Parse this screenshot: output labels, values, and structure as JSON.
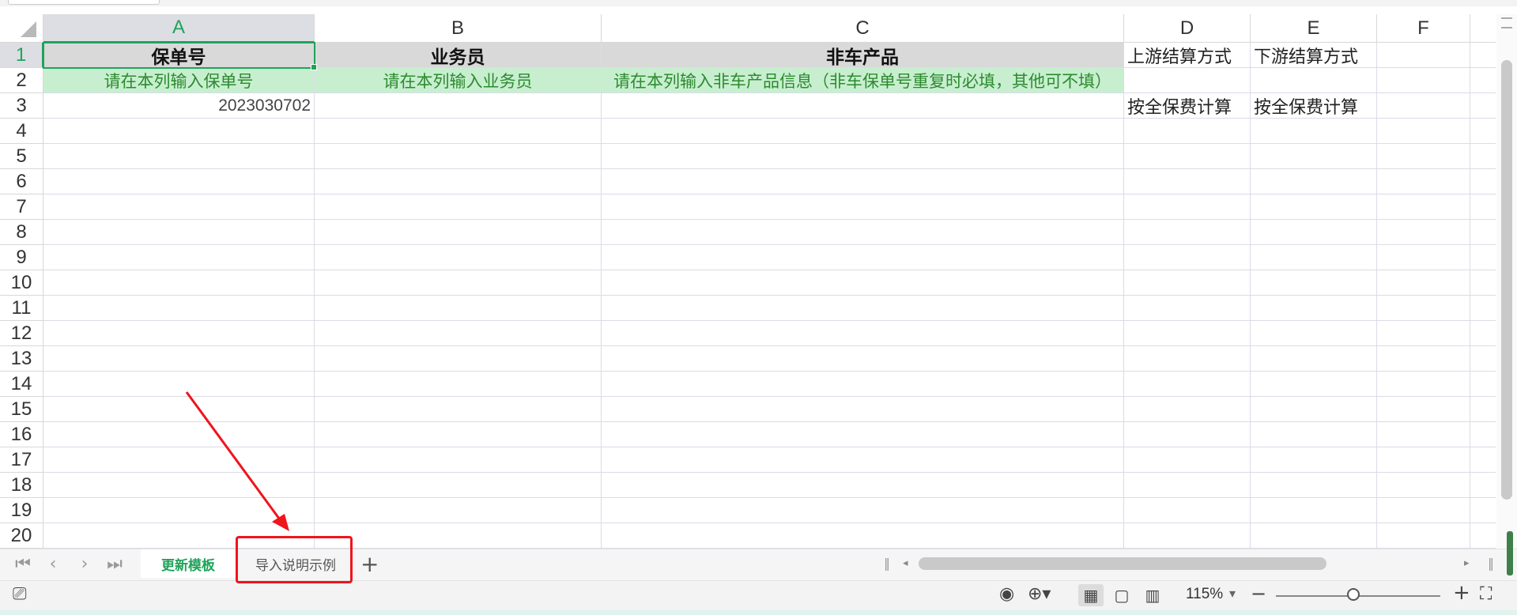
{
  "columns": [
    "A",
    "B",
    "C",
    "D",
    "E",
    "F"
  ],
  "rows": [
    "1",
    "2",
    "3",
    "4",
    "5",
    "6",
    "7",
    "8",
    "9",
    "10",
    "11",
    "12",
    "13",
    "14",
    "15",
    "16",
    "17",
    "18",
    "19",
    "20"
  ],
  "cells": {
    "r1": {
      "a": "保单号",
      "b": "业务员",
      "c": "非车产品",
      "d": "上游结算方式",
      "e": "下游结算方式"
    },
    "r2": {
      "a": "请在本列输入保单号",
      "b": "请在本列输入业务员",
      "c": "请在本列输入非车产品信息（非车保单号重复时必填，其他可不填）"
    },
    "r3": {
      "a": "2023030702",
      "d": "按全保费计算",
      "e": "按全保费计算"
    }
  },
  "selected_cell": "A1",
  "sheet_nav": {
    "first": "⏮",
    "prev": "‹",
    "next": "›",
    "last": "⏭"
  },
  "sheets": [
    {
      "label": "更新模板",
      "active": true
    },
    {
      "label": "导入说明示例",
      "active": false
    }
  ],
  "add_sheet": "+",
  "status": {
    "zoom": "115%",
    "zoom_out": "−",
    "zoom_in": "+",
    "zoom_fraction": 0.47
  },
  "colors": {
    "accent": "#1fa35b",
    "annotation": "#f0141b",
    "header_fill": "#d9d9d9",
    "hint_fill": "#c7efcf"
  }
}
